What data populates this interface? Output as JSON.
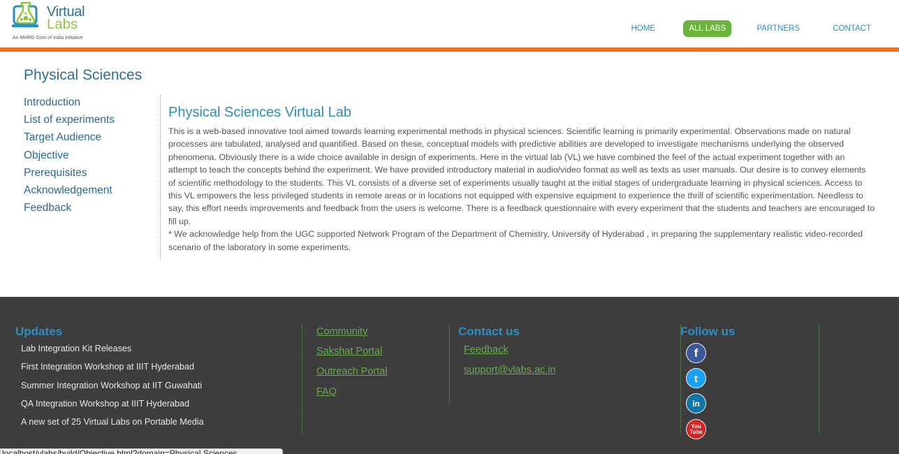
{
  "header": {
    "logo_line1": "Virtual",
    "logo_line2": "Labs",
    "logo_tagline": "An MHRD Govt of India Initiative",
    "nav": [
      {
        "label": "HOME"
      },
      {
        "label": "ALL LABS"
      },
      {
        "label": "PARTNERS"
      },
      {
        "label": "CONTACT"
      }
    ]
  },
  "main": {
    "page_title": "Physical Sciences",
    "sidebar": [
      {
        "label": "Introduction"
      },
      {
        "label": "List of experiments"
      },
      {
        "label": "Target Audience"
      },
      {
        "label": "Objective"
      },
      {
        "label": "Prerequisites"
      },
      {
        "label": "Acknowledgement"
      },
      {
        "label": "Feedback"
      }
    ],
    "heading": "Physical Sciences Virtual Lab",
    "paragraph1": "This is a web-based innovative tool aimed towards learning experimental methods in physical sciences. Scientific learning is primarily experimental. Observations made on natural processes are tabulated, analysed and quantified. Based on these, conceptual models with predictive abilities are developed to investigate mechanisms underlying the observed phenomena. Obviously there is a wide choice available in design of experiments. Here in the virtual lab (VL) we have combined the feel of the actual experiment together with an attempt to teach the concepts behind the experiment. We have provided introductory material in audio/video format as well as texts as user manuals. Our desire is to convey elements of scientific methodology to the students. This VL consists of a diverse set of experiments usually taught at the initial stages of undergraduate learning in physical sciences. Access to this VL empowers the less privileged students in remote areas or in locations not equipped with expensive equipment to experience the thrill of scientific experimentation. Needless to say, this effort needs improvements and feedback from the users is welcome. There is a feedback questionnaire with every experiment that the students and teachers are encouraged to fill up.",
    "paragraph2": "* We acknowledge help from the UGC supported Network Program of the Department of Chemistry, University of Hyderabad , in preparing the supplementary realistic video-recorded scenario of the laboratory in some experiments."
  },
  "footer": {
    "updates_heading": "Updates",
    "updates": [
      {
        "label": "Lab Integration Kit Releases"
      },
      {
        "label": "First Integration Workshop at IIIT Hyderabad"
      },
      {
        "label": "Summer Integration Workshop at IIT Guwahati"
      },
      {
        "label": "QA Integration Workshop at IIIT Hyderabad"
      },
      {
        "label": "A new set of 25 Virtual Labs on Portable Media"
      }
    ],
    "links": [
      {
        "label": "Community"
      },
      {
        "label": "Sakshat Portal"
      },
      {
        "label": "Outreach Portal"
      },
      {
        "label": "FAQ"
      }
    ],
    "contact_heading": "Contact us",
    "contact_links": [
      {
        "label": "Feedback"
      },
      {
        "label": "support@vlabs.ac.in"
      }
    ],
    "follow_heading": "Follow us",
    "social": [
      {
        "icon": "facebook-icon",
        "glyph": "f"
      },
      {
        "icon": "twitter-icon",
        "glyph": "t"
      },
      {
        "icon": "linkedin-icon",
        "glyph": "in"
      },
      {
        "icon": "youtube-icon",
        "glyph_top": "You",
        "glyph_bottom": "Tube"
      }
    ]
  },
  "statusbar": {
    "text": "localhost/vlabs/build/Objective.html?domain=Physical Sciences"
  },
  "colors": {
    "accent_orange": "#f26f21",
    "nav_active": "#6ab43e",
    "link_blue": "#2b8fc5",
    "footer_bg": "#3d3d3d",
    "footer_link": "#6aa84f"
  }
}
